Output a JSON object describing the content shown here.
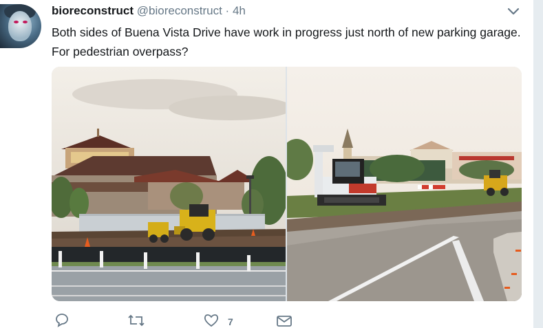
{
  "tweet": {
    "author_name": "bioreconstruct",
    "author_handle": "@bioreconstruct",
    "separator": "·",
    "timestamp": "4h",
    "text": "Both sides of Buena Vista Drive have work in progress just north of new parking garage. For pedestrian overpass?"
  },
  "actions": {
    "like_count": "7"
  },
  "icons": {
    "caret": "chevron-down-icon",
    "reply": "reply-icon",
    "retweet": "retweet-icon",
    "like": "heart-icon",
    "message": "envelope-icon"
  },
  "colors": {
    "text": "#14171a",
    "secondary": "#657786",
    "background": "#ffffff",
    "gutter": "#e6ecf0"
  }
}
